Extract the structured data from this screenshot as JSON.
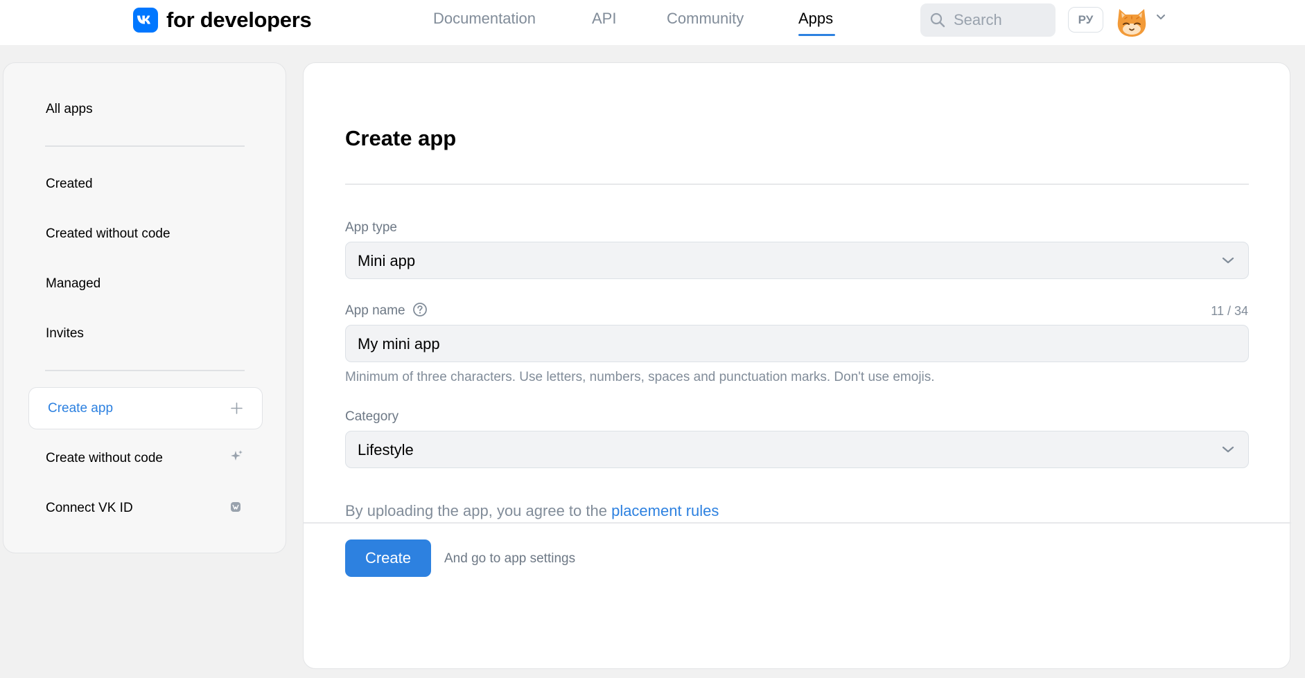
{
  "header": {
    "logo_badge": "vk",
    "logo_text": "for developers",
    "nav": [
      "Documentation",
      "API",
      "Community",
      "Apps"
    ],
    "active_nav": "Apps",
    "search_placeholder": "Search",
    "lang": "РУ",
    "avatar_icon": "cat-avatar-icon",
    "accent": "#2d81e0"
  },
  "sidebar": {
    "all_apps": "All apps",
    "items": [
      "Created",
      "Created without code",
      "Managed",
      "Invites"
    ],
    "create_app": "Create app",
    "create_without_code": "Create without code",
    "connect_vk_id": "Connect VK ID",
    "icons": [
      "plus-icon",
      "sparkle-icon",
      "vk-id-icon"
    ]
  },
  "main": {
    "title": "Create app",
    "app_type_label": "App type",
    "app_type_value": "Mini app",
    "app_name_label": "App name",
    "app_name_value": "My mini app",
    "app_name_counter": "11 / 34",
    "app_name_hint": "Minimum of three characters. Use letters, numbers, spaces and punctuation marks. Don't use emojis.",
    "category_label": "Category",
    "category_value": "Lifestyle",
    "agree_text": "By uploading the app, you agree to the ",
    "agree_link": "placement rules",
    "create_button": "Create",
    "create_aside": "And go to app settings"
  }
}
